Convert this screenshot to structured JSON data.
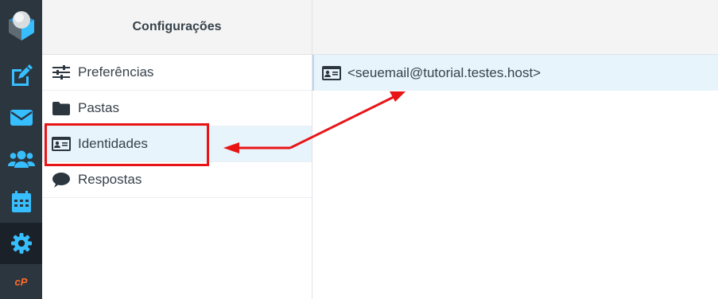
{
  "colors": {
    "rail_bg": "#2c363f",
    "rail_icon": "#37beff",
    "rail_active_bg": "#1b2128",
    "cpanel_orange": "#ff6c2c",
    "selected_bg": "#e8f4fb",
    "annotation_red": "#e81416"
  },
  "rail": {
    "logo_icon": "roundcube-logo",
    "items": [
      {
        "icon": "compose-icon",
        "active": false
      },
      {
        "icon": "mail-icon",
        "active": false
      },
      {
        "icon": "contacts-icon",
        "active": false
      },
      {
        "icon": "calendar-icon",
        "active": false
      },
      {
        "icon": "settings-gear-icon",
        "active": true
      }
    ],
    "cpanel_label": "cP"
  },
  "settings": {
    "title": "Configurações",
    "items": [
      {
        "label": "Preferências",
        "icon": "sliders-icon",
        "selected": false
      },
      {
        "label": "Pastas",
        "icon": "folder-icon",
        "selected": false
      },
      {
        "label": "Identidades",
        "icon": "id-card-icon",
        "selected": true
      },
      {
        "label": "Respostas",
        "icon": "comment-icon",
        "selected": false
      }
    ]
  },
  "identities": {
    "items": [
      {
        "label": "<seuemail@tutorial.testes.host>",
        "icon": "id-card-icon"
      }
    ]
  }
}
